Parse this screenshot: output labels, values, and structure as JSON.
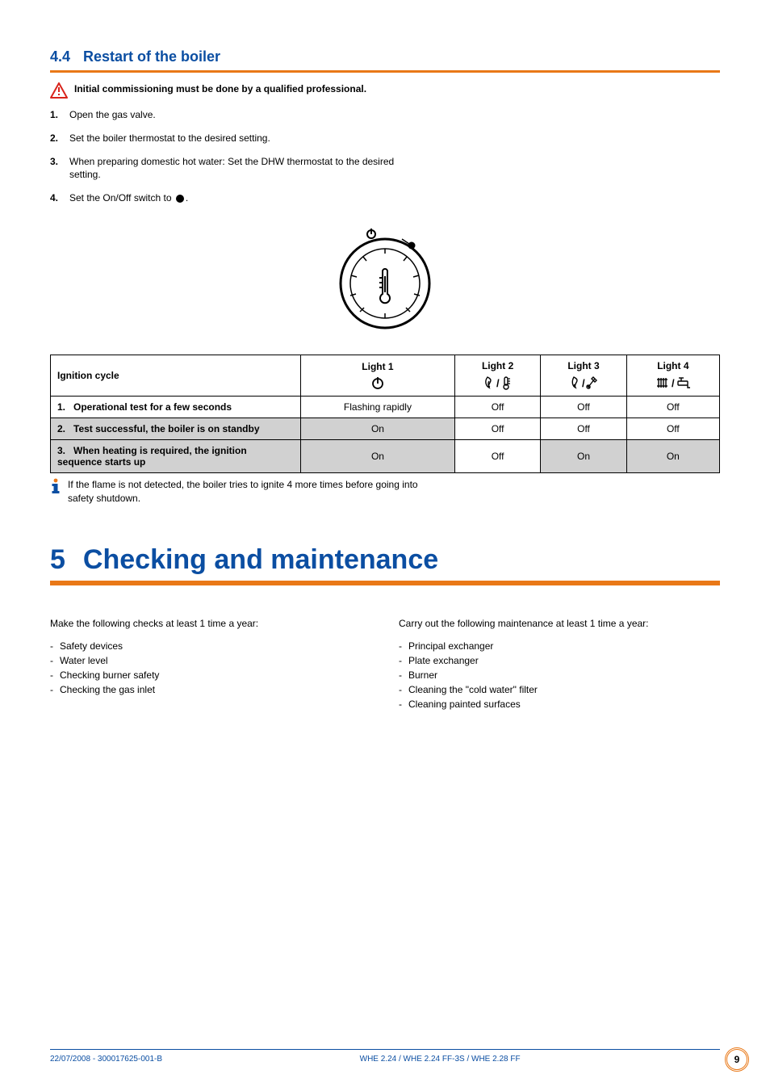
{
  "section44": {
    "number": "4.4",
    "title": "Restart of the boiler",
    "warning": "Initial commissioning must be done by a qualified professional.",
    "steps": [
      {
        "n": "1.",
        "t": "Open the gas valve."
      },
      {
        "n": "2.",
        "t": "Set the boiler thermostat to the desired setting."
      },
      {
        "n": "3.",
        "t": "When preparing domestic hot water: Set the DHW thermostat to the desired setting."
      },
      {
        "n": "4.",
        "t_pre": "Set the On/Off switch to ",
        "t_post": "."
      }
    ]
  },
  "table": {
    "cycle_label": "Ignition cycle",
    "lights": [
      "Light 1",
      "Light 2",
      "Light 3",
      "Light 4"
    ],
    "rows": [
      {
        "n": "1.",
        "label": "Operational test for a few seconds",
        "v": [
          "Flashing rapidly",
          "Off",
          "Off",
          "Off"
        ],
        "gray": false
      },
      {
        "n": "2.",
        "label": "Test successful, the boiler is on standby",
        "v": [
          "On",
          "Off",
          "Off",
          "Off"
        ],
        "gray": true,
        "white_cols": [
          1,
          2,
          3
        ]
      },
      {
        "n": "3.",
        "label": "When heating is required, the ignition sequence starts up",
        "v": [
          "On",
          "Off",
          "On",
          "On"
        ],
        "gray": true,
        "white_cols": [
          1
        ]
      }
    ],
    "info": "If the flame is not detected, the boiler tries to ignite 4 more times before going into safety shutdown."
  },
  "chapter5": {
    "number": "5",
    "title": "Checking and maintenance",
    "col1_lead": "Make the following checks at least 1 time a year:",
    "col1_items": [
      "Safety devices",
      "Water level",
      "Checking burner safety",
      "Checking the gas inlet"
    ],
    "col2_lead": "Carry out the following maintenance at least 1 time a year:",
    "col2_items": [
      "Principal exchanger",
      "Plate exchanger",
      "Burner",
      "Cleaning the \"cold water\" filter",
      "Cleaning painted surfaces"
    ]
  },
  "footer": {
    "left": "22/07/2008 - 300017625-001-B",
    "center": "WHE 2.24 / WHE 2.24 FF-3S / WHE 2.28 FF",
    "page": "9"
  }
}
